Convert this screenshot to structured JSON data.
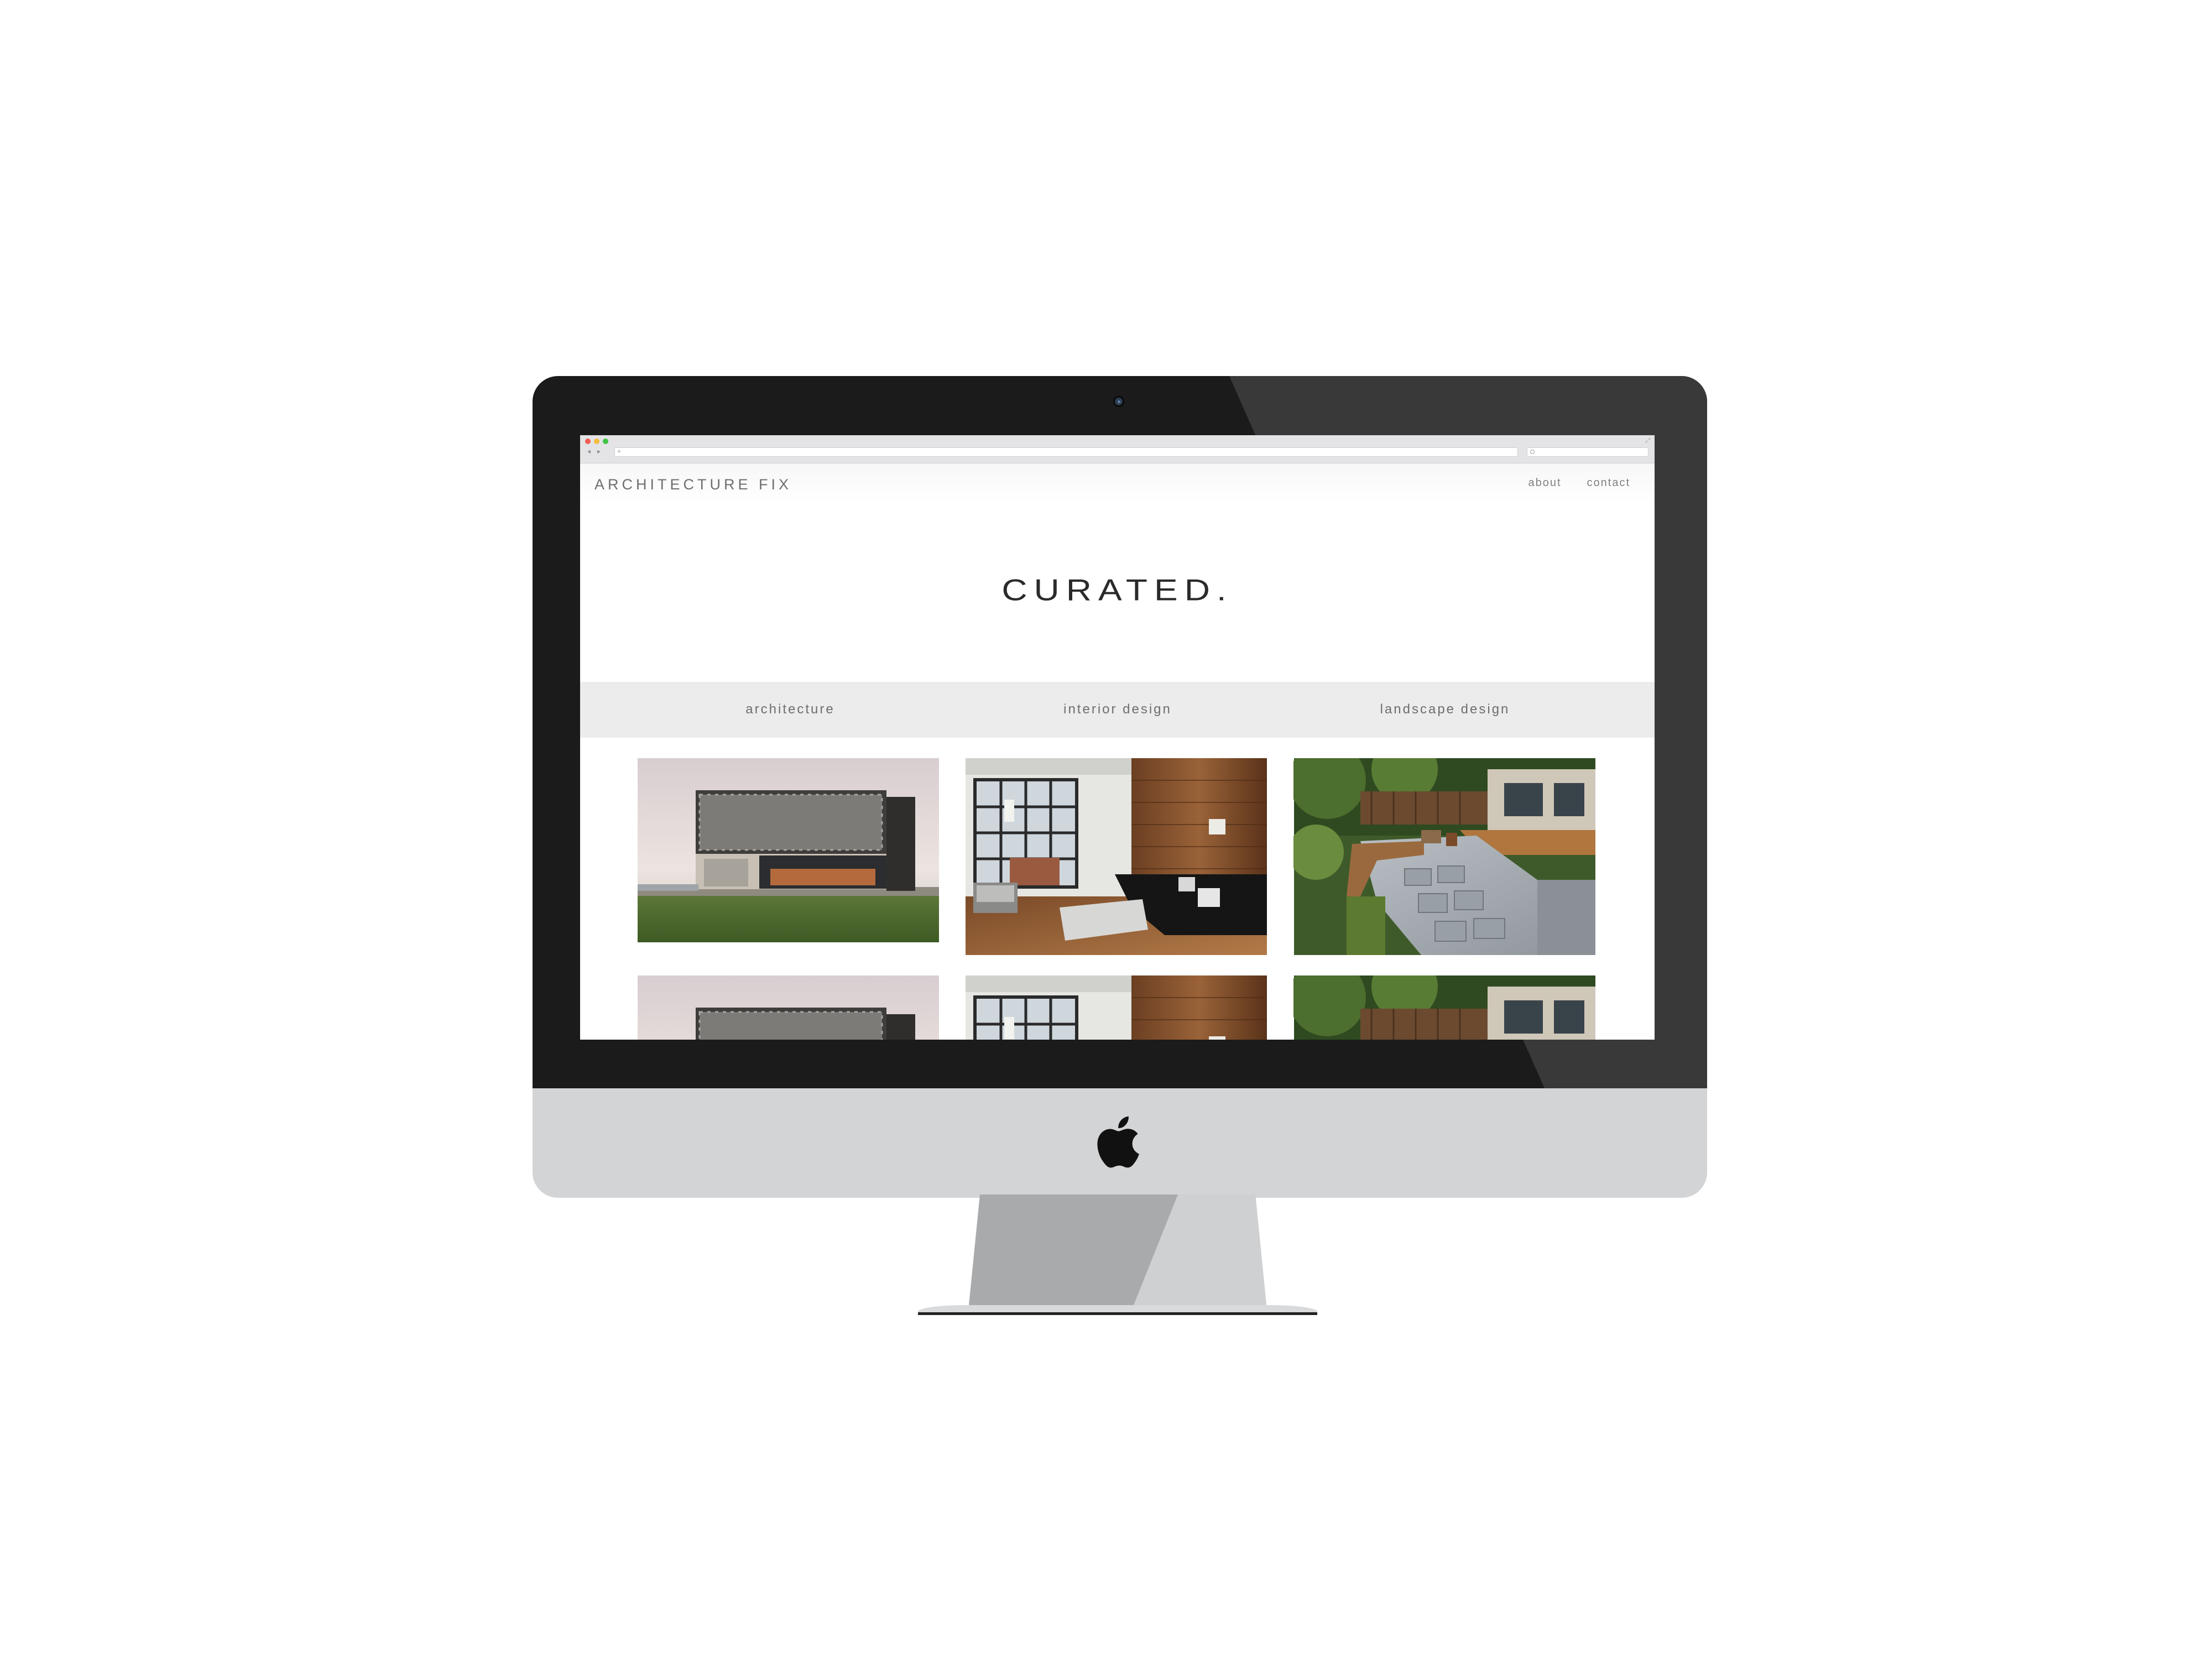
{
  "browser": {
    "nav_back": "◂",
    "nav_forward": "▸",
    "url_plus": "+",
    "expand": "⤢"
  },
  "site": {
    "brand": "ARCHITECTURE FIX",
    "nav": [
      "about",
      "contact"
    ],
    "hero_title": "CURATED.",
    "categories": [
      "architecture",
      "interior design",
      "landscape design"
    ]
  },
  "gallery": {
    "images": [
      "modern-house-photo",
      "loft-living-room-photo",
      "backyard-patio-photo"
    ]
  },
  "colors": {
    "bezel": "#1b1b1b",
    "chin": "#d3d4d6",
    "category_bar": "#ececec",
    "brand_text": "#6e6e6e"
  }
}
